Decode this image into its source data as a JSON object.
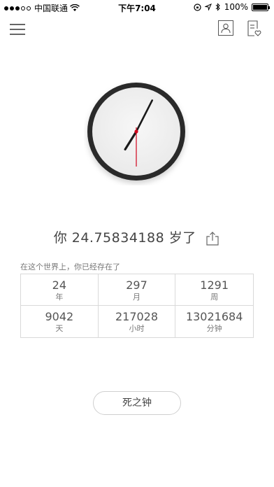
{
  "status_bar": {
    "carrier": "中国联通",
    "time": "下午7:04",
    "battery": "100%"
  },
  "header": {
    "menu_icon": "hamburger-icon",
    "profile_icon": "person-icon",
    "list_icon": "list-heart-icon"
  },
  "clock": {
    "hour": 19,
    "minute": 4,
    "second": 30
  },
  "age": {
    "prefix": "你",
    "value": "24.75834188",
    "suffix": "岁了"
  },
  "subtitle": "在这个世界上，你已经存在了",
  "stats": [
    {
      "value": "24",
      "unit": "年"
    },
    {
      "value": "297",
      "unit": "月"
    },
    {
      "value": "1291",
      "unit": "周"
    },
    {
      "value": "9042",
      "unit": "天"
    },
    {
      "value": "217028",
      "unit": "小时"
    },
    {
      "value": "13021684",
      "unit": "分钟"
    }
  ],
  "death_button": "死之钟",
  "colors": {
    "second_hand": "#d0021b",
    "hands": "#1a1a1a",
    "bezel": "#2b2b2b"
  }
}
